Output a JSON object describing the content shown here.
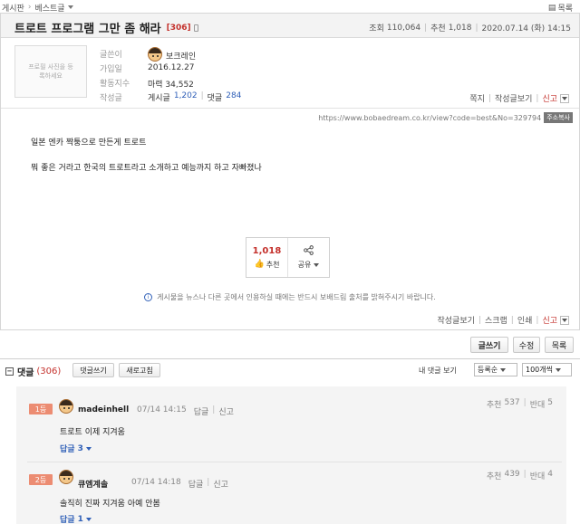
{
  "breadcrumb": {
    "home": "게시판",
    "board": "베스트글"
  },
  "top_right": {
    "list_link": "목록"
  },
  "post": {
    "title": "트로트 프로그램 그만 좀 해라",
    "comment_count_tag": "[306]",
    "views_label": "조회",
    "views": "110,064",
    "likes_label": "추천",
    "likes": "1,018",
    "date": "2020.07.14 (화) 14:15",
    "author": {
      "photo_placeholder": "프로필 사진을 등록하세요",
      "labels": {
        "writer": "글쓴이",
        "joined": "가입일",
        "activity": "활동지수",
        "posts": "작성글"
      },
      "name": "보크레인",
      "joined": "2016.12.27",
      "activity": "마력 34,552",
      "posts_label": "게시글",
      "posts_count": "1,202",
      "comments_label": "댓글",
      "comments_count": "284"
    },
    "actions": {
      "note": "쪽지",
      "view_posts": "작성글보기",
      "report": "신고"
    },
    "url": "https://www.bobaedream.co.kr/view?code=best&No=329794",
    "copy_url": "주소복사",
    "body_lines": [
      "일본 엔카 짝퉁으로 만든게 트로트",
      "뭐 좋은 거라고 한국의 트로트라고 소개하고 예능까지 하고 자빠졌나"
    ],
    "recommend": {
      "count": "1,018",
      "label": "추천"
    },
    "share": {
      "label": "공유"
    },
    "notice": "게시물을 뉴스나 다른 곳에서 인용하실 때에는 반드시 보배드림 출처를 밝혀주시기 바랍니다.",
    "bottom_actions": {
      "view_posts": "작성글보기",
      "scrap": "스크랩",
      "print": "인쇄",
      "report": "신고"
    }
  },
  "toolbar": {
    "write": "글쓰기",
    "edit": "수정",
    "list": "목록"
  },
  "comments_header": {
    "title": "댓글",
    "count": "(306)",
    "write_button": "댓글쓰기",
    "refresh_button": "새로고침",
    "my_comments": "내 댓글 보기",
    "sort_select": "등록순",
    "page_size_select": "100개씩"
  },
  "comments": [
    {
      "rank": "1등",
      "author": "madeinhell",
      "time": "07/14 14:15",
      "reply_link": "답글",
      "report_link": "신고",
      "up_label": "추천",
      "up": "537",
      "down_label": "반대",
      "down": "5",
      "text": "트로트 이제 지겨움",
      "replies_label": "답글",
      "replies": "3"
    },
    {
      "rank": "2등",
      "author": "큐엠계솔",
      "time": "07/14 14:18",
      "reply_link": "답글",
      "report_link": "신고",
      "up_label": "추천",
      "up": "439",
      "down_label": "반대",
      "down": "4",
      "text": "솔직히 진짜 지겨움 아예 안봄",
      "replies_label": "답글",
      "replies": "1"
    }
  ]
}
